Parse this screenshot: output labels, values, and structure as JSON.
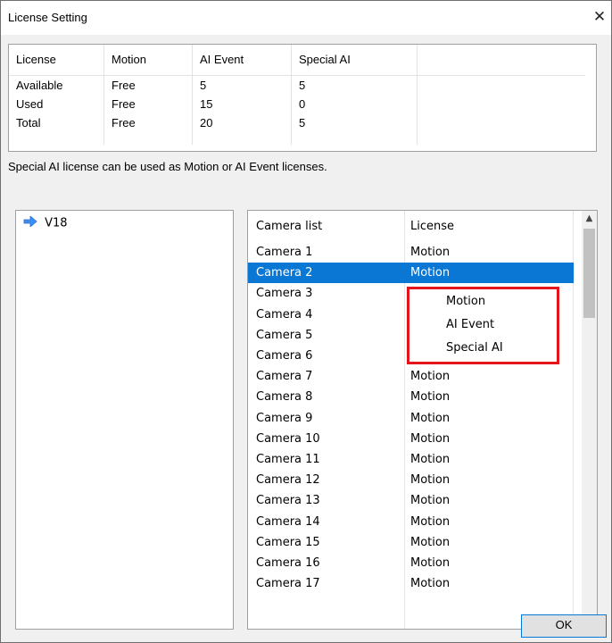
{
  "window": {
    "title": "License Setting",
    "close_glyph": "✕"
  },
  "license_table": {
    "headers": [
      "License",
      "Motion",
      "AI Event",
      "Special AI"
    ],
    "rows": [
      [
        "Available",
        "Free",
        "5",
        "5"
      ],
      [
        "Used",
        "Free",
        "15",
        "0"
      ],
      [
        "Total",
        "Free",
        "20",
        "5"
      ]
    ]
  },
  "note": "Special AI license can be used as Motion or AI Event licenses.",
  "tree": {
    "item": "V18",
    "icon": "blue-arrow-right-icon"
  },
  "camera_table": {
    "headers": [
      "Camera list",
      "License"
    ],
    "rows": [
      {
        "camera": "Camera 1",
        "license": "Motion"
      },
      {
        "camera": "Camera 2",
        "license": "Motion",
        "selected": true
      },
      {
        "camera": "Camera 3",
        "license": ""
      },
      {
        "camera": "Camera 4",
        "license": ""
      },
      {
        "camera": "Camera 5",
        "license": ""
      },
      {
        "camera": "Camera 6",
        "license": ""
      },
      {
        "camera": "Camera 7",
        "license": "Motion"
      },
      {
        "camera": "Camera 8",
        "license": "Motion"
      },
      {
        "camera": "Camera 9",
        "license": "Motion"
      },
      {
        "camera": "Camera 10",
        "license": "Motion"
      },
      {
        "camera": "Camera 11",
        "license": "Motion"
      },
      {
        "camera": "Camera 12",
        "license": "Motion"
      },
      {
        "camera": "Camera 13",
        "license": "Motion"
      },
      {
        "camera": "Camera 14",
        "license": "Motion"
      },
      {
        "camera": "Camera 15",
        "license": "Motion"
      },
      {
        "camera": "Camera 16",
        "license": "Motion"
      },
      {
        "camera": "Camera 17",
        "license": "Motion"
      }
    ]
  },
  "dropdown": {
    "options": [
      "Motion",
      "AI Event",
      "Special AI"
    ],
    "highlight_color": "#e3141b"
  },
  "ok_label": "OK",
  "colors": {
    "selection": "#0a77d5",
    "accent": "#0078d7"
  }
}
